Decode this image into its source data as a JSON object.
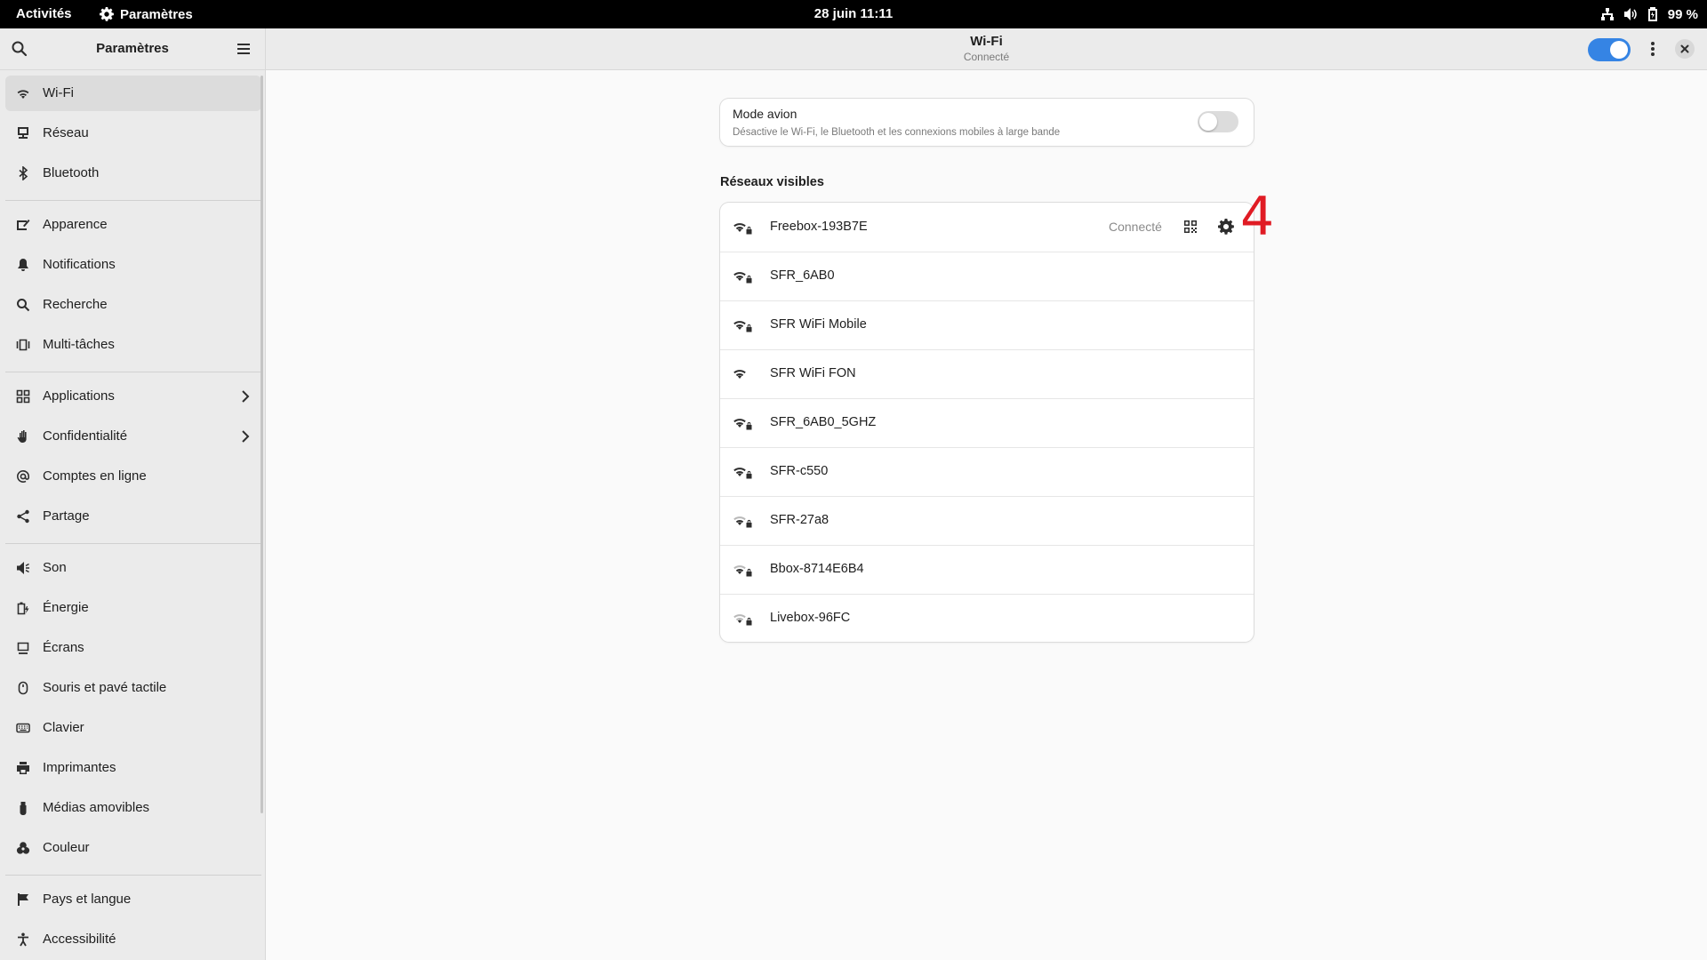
{
  "topbar": {
    "activities": "Activités",
    "app_name": "Paramètres",
    "clock": "28 juin  11:11",
    "battery": "99 %"
  },
  "sidebar": {
    "title": "Paramètres",
    "items": [
      {
        "label": "Wi-Fi",
        "icon": "wifi-icon",
        "active": true
      },
      {
        "label": "Réseau",
        "icon": "network-icon"
      },
      {
        "label": "Bluetooth",
        "icon": "bluetooth-icon"
      },
      {
        "label": "Apparence",
        "icon": "appearance-icon"
      },
      {
        "label": "Notifications",
        "icon": "bell-icon"
      },
      {
        "label": "Recherche",
        "icon": "search-icon"
      },
      {
        "label": "Multi-tâches",
        "icon": "multitask-icon"
      },
      {
        "label": "Applications",
        "icon": "apps-grid-icon",
        "submenu": true
      },
      {
        "label": "Confidentialité",
        "icon": "hand-icon",
        "submenu": true
      },
      {
        "label": "Comptes en ligne",
        "icon": "at-icon"
      },
      {
        "label": "Partage",
        "icon": "share-icon"
      },
      {
        "label": "Son",
        "icon": "speaker-icon"
      },
      {
        "label": "Énergie",
        "icon": "battery-icon"
      },
      {
        "label": "Écrans",
        "icon": "display-icon"
      },
      {
        "label": "Souris et pavé tactile",
        "icon": "mouse-icon"
      },
      {
        "label": "Clavier",
        "icon": "keyboard-icon"
      },
      {
        "label": "Imprimantes",
        "icon": "printer-icon"
      },
      {
        "label": "Médias amovibles",
        "icon": "usb-icon"
      },
      {
        "label": "Couleur",
        "icon": "color-icon"
      },
      {
        "label": "Pays et langue",
        "icon": "flag-icon"
      },
      {
        "label": "Accessibilité",
        "icon": "accessibility-icon"
      }
    ]
  },
  "header": {
    "title": "Wi-Fi",
    "subtitle": "Connecté",
    "wifi_enabled": true
  },
  "airplane": {
    "title": "Mode avion",
    "description": "Désactive le Wi-Fi, le Bluetooth et les connexions mobiles à large bande",
    "enabled": false
  },
  "networks": {
    "heading": "Réseaux visibles",
    "items": [
      {
        "name": "Freebox-193B7E",
        "status": "Connecté",
        "signal": 4,
        "secured": true
      },
      {
        "name": "SFR_6AB0",
        "signal": 4,
        "secured": true
      },
      {
        "name": "SFR WiFi Mobile",
        "signal": 4,
        "secured": true
      },
      {
        "name": "SFR WiFi FON",
        "signal": 4,
        "secured": false
      },
      {
        "name": "SFR_6AB0_5GHZ",
        "signal": 4,
        "secured": true
      },
      {
        "name": "SFR-c550",
        "signal": 4,
        "secured": true
      },
      {
        "name": "SFR-27a8",
        "signal": 2,
        "secured": true
      },
      {
        "name": "Bbox-8714E6B4",
        "signal": 2,
        "secured": true
      },
      {
        "name": "Livebox-96FC",
        "signal": 1,
        "secured": true
      }
    ]
  },
  "annotation": "4",
  "colors": {
    "accent": "#3584e4",
    "annotation": "#e01b24"
  }
}
